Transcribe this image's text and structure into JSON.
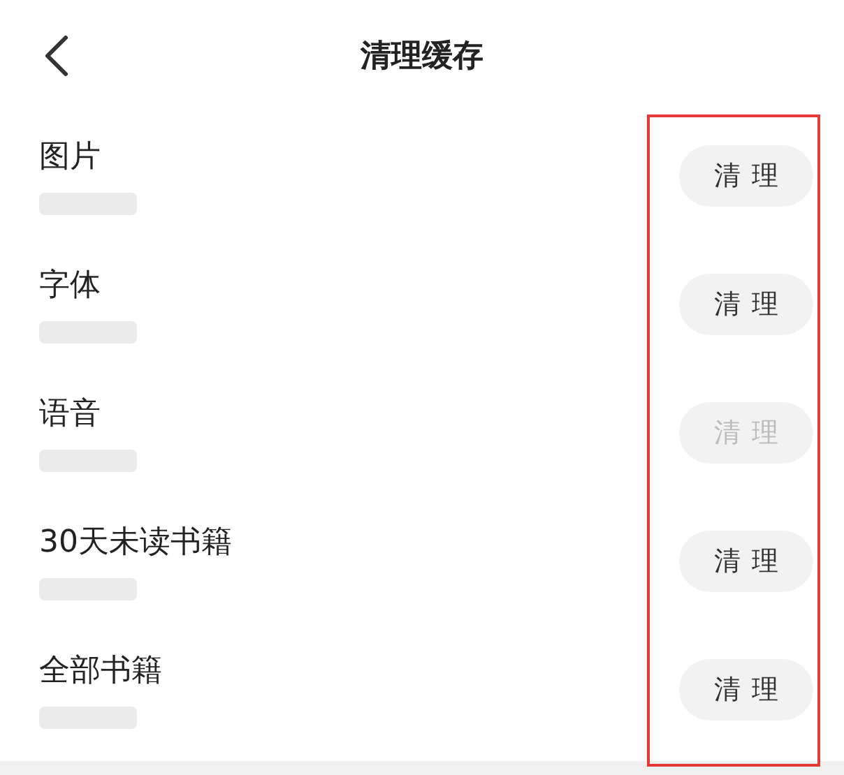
{
  "header": {
    "title": "清理缓存"
  },
  "items": [
    {
      "name": "图片",
      "size_redacted": true,
      "button": "清理",
      "disabled": false
    },
    {
      "name": "字体",
      "size_redacted": true,
      "button": "清理",
      "disabled": false
    },
    {
      "name": "语音",
      "size_redacted": true,
      "button": "清理",
      "disabled": true
    },
    {
      "name": "30天未读书籍",
      "size_redacted": true,
      "button": "清理",
      "disabled": false
    },
    {
      "name": "全部书籍",
      "size_redacted": true,
      "button": "清理",
      "disabled": false
    }
  ],
  "annotation_box": {
    "color": "#e53935"
  }
}
